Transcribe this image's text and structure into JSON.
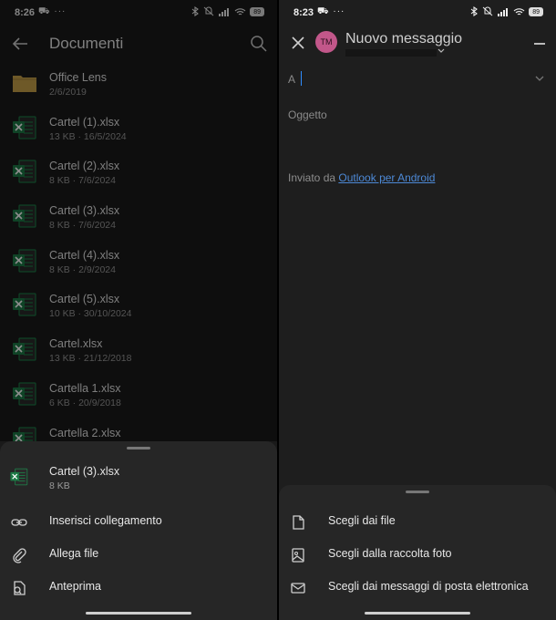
{
  "left": {
    "status": {
      "time": "8:26",
      "notif": "⛟ ···",
      "battery": "89"
    },
    "title": "Documenti",
    "files": [
      {
        "name": "Office Lens",
        "meta": "2/6/2019",
        "type": "folder"
      },
      {
        "name": "Cartel (1).xlsx",
        "meta": "13 KB · 16/5/2024",
        "type": "xlsx"
      },
      {
        "name": "Cartel (2).xlsx",
        "meta": "8 KB · 7/6/2024",
        "type": "xlsx"
      },
      {
        "name": "Cartel (3).xlsx",
        "meta": "8 KB · 7/6/2024",
        "type": "xlsx"
      },
      {
        "name": "Cartel (4).xlsx",
        "meta": "8 KB · 2/9/2024",
        "type": "xlsx"
      },
      {
        "name": "Cartel (5).xlsx",
        "meta": "10 KB · 30/10/2024",
        "type": "xlsx"
      },
      {
        "name": "Cartel.xlsx",
        "meta": "13 KB · 21/12/2018",
        "type": "xlsx"
      },
      {
        "name": "Cartella 1.xlsx",
        "meta": "6 KB · 20/9/2018",
        "type": "xlsx"
      },
      {
        "name": "Cartella 2.xlsx",
        "meta": "",
        "type": "xlsx"
      }
    ],
    "sheet": {
      "selected_name": "Cartel (3).xlsx",
      "selected_size": "8 KB",
      "items": [
        {
          "label": "Inserisci collegamento",
          "icon": "link-icon"
        },
        {
          "label": "Allega file",
          "icon": "paperclip-icon"
        },
        {
          "label": "Anteprima",
          "icon": "preview-icon"
        }
      ]
    }
  },
  "right": {
    "status": {
      "time": "8:23",
      "notif": "⛟ ···",
      "battery": "89"
    },
    "avatar": "TM",
    "title": "Nuovo messaggio",
    "to_label": "A",
    "subject_placeholder": "Oggetto",
    "signature_prefix": "Inviato da ",
    "signature_link": "Outlook per Android",
    "sheet": {
      "items": [
        {
          "label": "Scegli dai file",
          "icon": "file-icon"
        },
        {
          "label": "Scegli dalla raccolta foto",
          "icon": "image-icon"
        },
        {
          "label": "Scegli dai messaggi di posta elettronica",
          "icon": "mail-icon"
        }
      ]
    }
  },
  "colors": {
    "excel_green": "#1d7a46",
    "folder": "#c9a24a",
    "accent_link": "#4d89d6",
    "avatar": "#c2578a"
  }
}
